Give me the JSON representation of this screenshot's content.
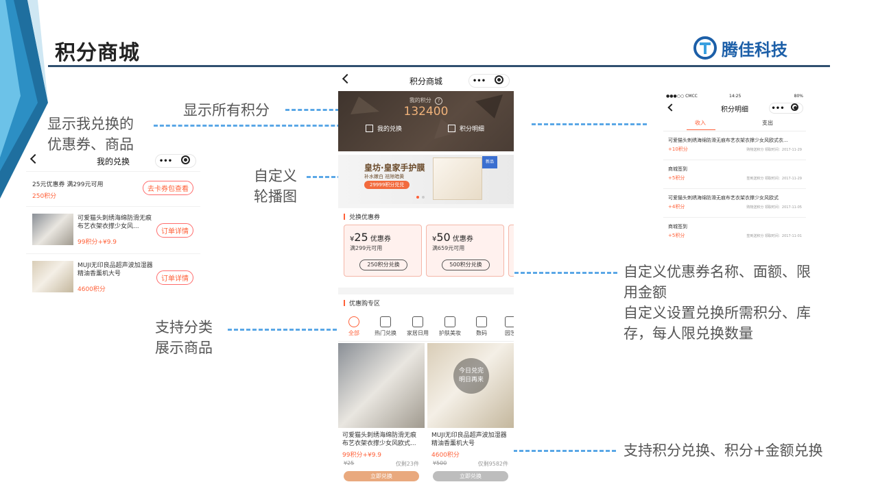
{
  "slide": {
    "title": "积分商城",
    "logo_text": "腾佳科技",
    "accent": "#2f4f6f"
  },
  "callouts": {
    "show_all_points": "显示所有积分",
    "show_redeemed_line1": "显示我兑换的",
    "show_redeemed_line2": "优惠券、商品",
    "custom_banner_line1": "自定义",
    "custom_banner_line2": "轮播图",
    "category_line1": "支持分类",
    "category_line2": "展示商品",
    "coupon_line1": "自定义优惠券名称、面额、限",
    "coupon_line2": "用金额",
    "coupon_line3": "自定义设置兑换所需积分、库",
    "coupon_line4": "存，每人限兑换数量",
    "exchange_modes": "支持积分兑换、积分+金额兑换"
  },
  "center_phone": {
    "title": "积分商城",
    "capsule_dots": "•••",
    "points_label": "我的积分",
    "points_help": "?",
    "points_value": "132400",
    "my_exchange": "我的兑换",
    "points_detail": "积分明细",
    "banner": {
      "title": "皇坊·皇家手护膜",
      "subtitle": "补水嫩白 祛除暗黄",
      "badge": "29999积分兑兑",
      "tag": "新品"
    },
    "coupon_section": "兑换优惠券",
    "coupons": [
      {
        "symbol": "¥",
        "amount": "25",
        "unit": "优惠券",
        "condition": "满299元可用",
        "button": "250积分兑换"
      },
      {
        "symbol": "¥",
        "amount": "50",
        "unit": "优惠券",
        "condition": "满659元可用",
        "button": "500积分兑换"
      }
    ],
    "deal_section": "优惠购专区",
    "categories": [
      {
        "label": "全部",
        "icon": "grid-icon",
        "active": true
      },
      {
        "label": "热门兑换",
        "icon": "flame-icon",
        "active": false
      },
      {
        "label": "家居日用",
        "icon": "lamp-icon",
        "active": false
      },
      {
        "label": "护肤美妆",
        "icon": "bottle-icon",
        "active": false
      },
      {
        "label": "数码",
        "icon": "camera-icon",
        "active": false
      },
      {
        "label": "园艺",
        "icon": "leaf-icon",
        "active": false
      }
    ],
    "soldout_line1": "今日兑完",
    "soldout_line2": "明日再来",
    "products": [
      {
        "name": "可爱猫头刺绣海绵防滑无痕布艺衣架衣撑少女风欧式...",
        "price": "99积分+¥9.9",
        "orig": "¥25",
        "stock": "仅剩23件",
        "button": "立即兑换"
      },
      {
        "name": "MUJI无印良品超声波加湿器精油香薰机大号",
        "price": "4600积分",
        "orig": "¥500",
        "stock": "仅剩9582件",
        "button": "立即兑换"
      }
    ]
  },
  "left_phone": {
    "title": "我的兑换",
    "capsule_dots": "•••",
    "coupon_item": {
      "name": "25元优惠券 满299元可用",
      "points": "250积分",
      "button": "去卡券包查看"
    },
    "orders": [
      {
        "name": "可爱猫头刺绣海绵防滑无痕布艺衣架衣撑少女风...",
        "price": "99积分+¥9.9",
        "button": "订单详情"
      },
      {
        "name": "MUJI无印良品超声波加湿器精油香薰机大号",
        "price": "4600积分",
        "button": "订单详情"
      }
    ]
  },
  "right_phone": {
    "status_carrier": "●●●○○ CMCC",
    "status_time": "14:25",
    "status_battery": "80%",
    "title": "积分明细",
    "capsule_dots": "•••",
    "tab_income": "收入",
    "tab_expense": "支出",
    "records": [
      {
        "name": "可爱猫头刺绣海绵防滑无痕布艺衣架衣撑少女风欧式衣...",
        "points": "+10积分",
        "meta": "购物送积分  领取时间：2017-11-29"
      },
      {
        "name": "商城签到",
        "points": "+5积分",
        "meta": "签到送积分  领取时间：2017-11-29"
      },
      {
        "name": "可爱猫头刺绣海绵防滑无痕布艺衣架衣撑少女风欧式",
        "points": "+4积分",
        "meta": "购物送积分  领取时间：2017-11-05"
      },
      {
        "name": "商城签到",
        "points": "+5积分",
        "meta": "签到送积分  领取时间：2017-11-01"
      }
    ]
  },
  "colors": {
    "primary_orange": "#ff5f37",
    "header_dark": "#4a3d35",
    "dashed_line": "#5aa7e6",
    "deco_blue": "#1f6f9f"
  }
}
